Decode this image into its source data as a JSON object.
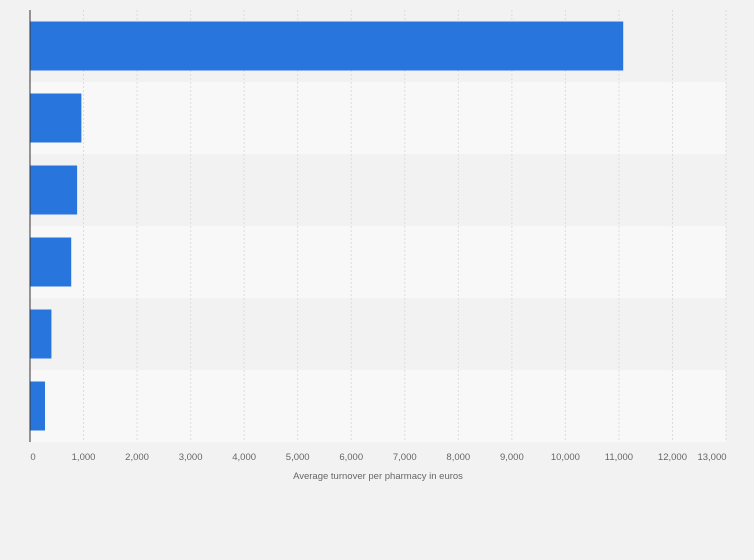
{
  "chart_data": {
    "type": "bar",
    "orientation": "horizontal",
    "categories": [
      "",
      "",
      "",
      "",
      "",
      ""
    ],
    "values": [
      11080,
      960,
      880,
      770,
      400,
      280
    ],
    "title": "",
    "xlabel": "Average turnover per pharmacy in euros",
    "ylabel": "",
    "xlim": [
      0,
      13000
    ],
    "xticks": [
      "0",
      "1,000",
      "2,000",
      "3,000",
      "4,000",
      "5,000",
      "6,000",
      "7,000",
      "8,000",
      "9,000",
      "10,000",
      "11,000",
      "12,000",
      "13,000"
    ],
    "grid": true,
    "bar_color": "#2876dd",
    "band_colors": [
      "#f2f2f2",
      "#f8f8f8"
    ],
    "background": "#f2f2f2",
    "gridline_color": "#dcdcdc",
    "axis_color": "#333333"
  }
}
